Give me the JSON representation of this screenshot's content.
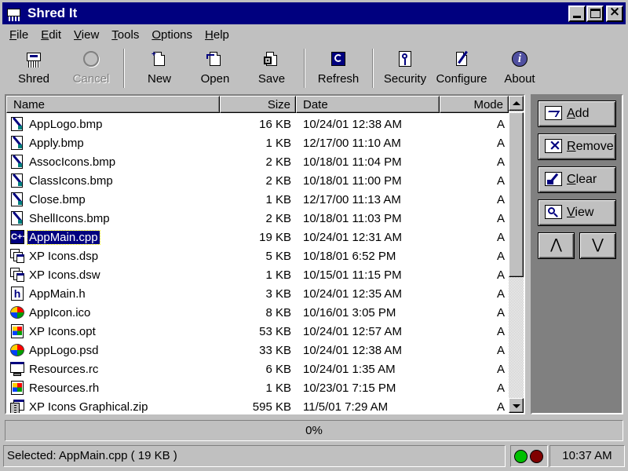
{
  "window": {
    "title": "Shred It"
  },
  "menu": [
    {
      "label": "File",
      "key": "F",
      "rest": "ile"
    },
    {
      "label": "Edit",
      "key": "E",
      "rest": "dit"
    },
    {
      "label": "View",
      "key": "V",
      "rest": "iew"
    },
    {
      "label": "Tools",
      "key": "T",
      "rest": "ools"
    },
    {
      "label": "Options",
      "key": "O",
      "rest": "ptions"
    },
    {
      "label": "Help",
      "key": "H",
      "rest": "elp"
    }
  ],
  "toolbar": {
    "shred": "Shred",
    "cancel": "Cancel",
    "new": "New",
    "open": "Open",
    "save": "Save",
    "refresh": "Refresh",
    "security": "Security",
    "configure": "Configure",
    "about": "About"
  },
  "columns": {
    "name": "Name",
    "size": "Size",
    "date": "Date",
    "mode": "Mode"
  },
  "files": [
    {
      "name": "AppLogo.bmp",
      "size": "16 KB",
      "date": "10/24/01 12:38 AM",
      "mode": "A",
      "icon": "bitmap-file-icon"
    },
    {
      "name": "Apply.bmp",
      "size": "1 KB",
      "date": "12/17/00 11:10 AM",
      "mode": "A",
      "icon": "bitmap-file-icon"
    },
    {
      "name": "AssocIcons.bmp",
      "size": "2 KB",
      "date": "10/18/01 11:04 PM",
      "mode": "A",
      "icon": "bitmap-file-icon"
    },
    {
      "name": "ClassIcons.bmp",
      "size": "2 KB",
      "date": "10/18/01 11:00 PM",
      "mode": "A",
      "icon": "bitmap-file-icon"
    },
    {
      "name": "Close.bmp",
      "size": "1 KB",
      "date": "12/17/00 11:13 AM",
      "mode": "A",
      "icon": "bitmap-file-icon"
    },
    {
      "name": "ShellIcons.bmp",
      "size": "2 KB",
      "date": "10/18/01 11:03 PM",
      "mode": "A",
      "icon": "bitmap-file-icon"
    },
    {
      "name": "AppMain.cpp",
      "size": "19 KB",
      "date": "10/24/01 12:31 AM",
      "mode": "A",
      "icon": "cpp-file-icon",
      "selected": true
    },
    {
      "name": "XP Icons.dsp",
      "size": "5 KB",
      "date": "10/18/01 6:52 PM",
      "mode": "A",
      "icon": "project-file-icon"
    },
    {
      "name": "XP Icons.dsw",
      "size": "1 KB",
      "date": "10/15/01 11:15 PM",
      "mode": "A",
      "icon": "project-file-icon"
    },
    {
      "name": "AppMain.h",
      "size": "3 KB",
      "date": "10/24/01 12:35 AM",
      "mode": "A",
      "icon": "header-file-icon"
    },
    {
      "name": "AppIcon.ico",
      "size": "8 KB",
      "date": "10/16/01 3:05 PM",
      "mode": "A",
      "icon": "windows-logo-icon"
    },
    {
      "name": "XP Icons.opt",
      "size": "53 KB",
      "date": "10/24/01 12:57 AM",
      "mode": "A",
      "icon": "windows-file-icon"
    },
    {
      "name": "AppLogo.psd",
      "size": "33 KB",
      "date": "10/24/01 12:38 AM",
      "mode": "A",
      "icon": "windows-logo-icon"
    },
    {
      "name": "Resources.rc",
      "size": "6 KB",
      "date": "10/24/01 1:35 AM",
      "mode": "A",
      "icon": "resource-file-icon"
    },
    {
      "name": "Resources.rh",
      "size": "1 KB",
      "date": "10/23/01 7:15 PM",
      "mode": "A",
      "icon": "windows-file-icon"
    },
    {
      "name": "XP Icons Graphical.zip",
      "size": "595 KB",
      "date": "11/5/01 7:29 AM",
      "mode": "A",
      "icon": "zip-file-icon"
    }
  ],
  "side": {
    "add": "Add",
    "add_key": "A",
    "add_rest": "dd",
    "remove": "Remove",
    "remove_key": "R",
    "remove_rest": "emove",
    "clear": "Clear",
    "clear_key": "C",
    "clear_rest": "lear",
    "view": "View",
    "view_key": "V",
    "view_rest": "iew",
    "up": "⋀",
    "down": "⋁"
  },
  "progress": {
    "text": "0%",
    "value": 0
  },
  "status": {
    "text": "Selected: AppMain.cpp ( 19 KB )",
    "time": "10:37 AM"
  },
  "colors": {
    "title_bar": "#00007f",
    "selection": "#00007f",
    "face": "#c0c0c0",
    "led_green": "#00c000",
    "led_red": "#800000"
  }
}
